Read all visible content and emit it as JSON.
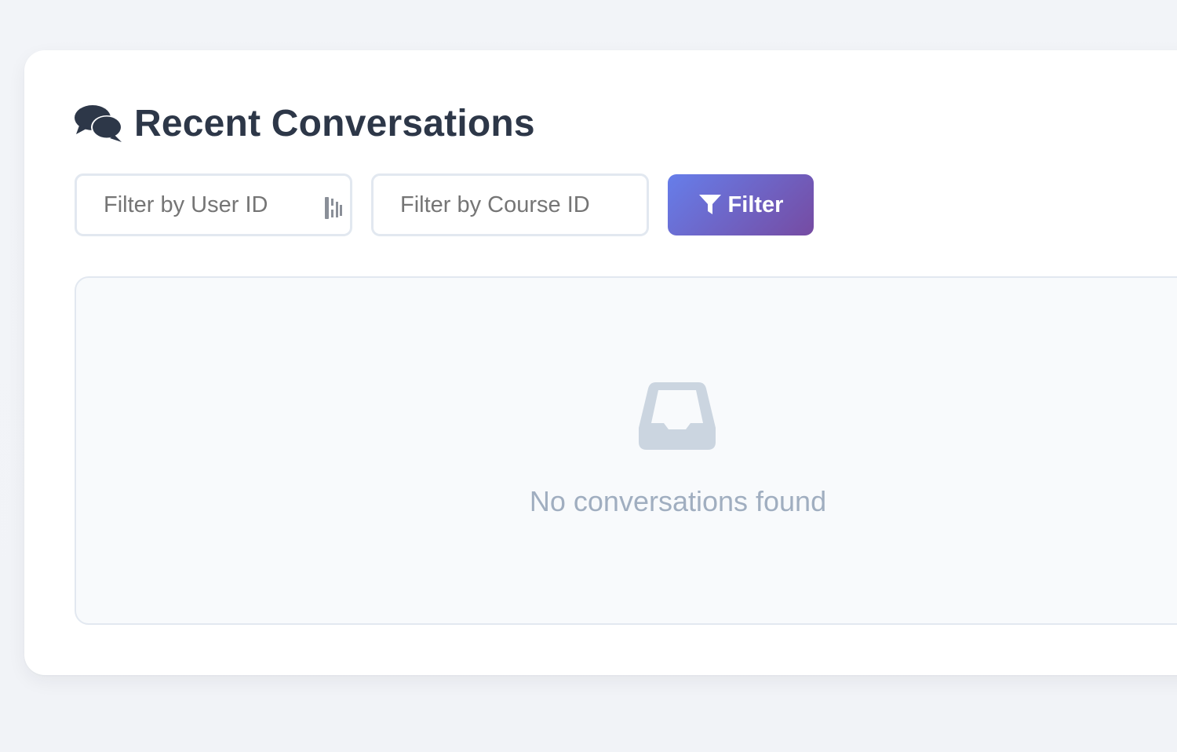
{
  "page": {
    "title": "Recent Conversations",
    "title_icon": "comments-icon"
  },
  "filters": {
    "user_id": {
      "placeholder": "Filter by User ID",
      "value": ""
    },
    "course_id": {
      "placeholder": "Filter by Course ID",
      "value": ""
    },
    "button": {
      "label": "Filter",
      "icon": "filter-icon"
    }
  },
  "results": {
    "empty_message": "No conversations found",
    "empty_icon": "inbox-icon"
  },
  "colors": {
    "background": "#f1f3f7",
    "card": "#ffffff",
    "title": "#2d3748",
    "border": "#e2e8f0",
    "muted_text": "#a0aec0",
    "empty_icon": "#cbd5e0",
    "button_gradient_start": "#667eea",
    "button_gradient_end": "#764ba2"
  }
}
